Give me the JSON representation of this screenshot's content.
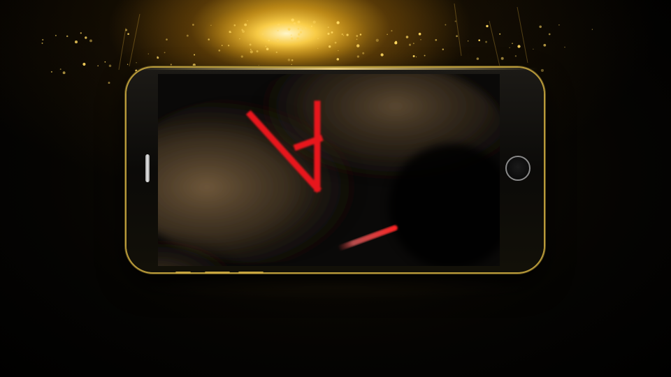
{
  "scene": {
    "colors": {
      "glow": "#f5c542",
      "phone_trim": "#b89a3a",
      "screen_bg": "#0a0908",
      "smoke": "#6b5330",
      "letter_red": "#e8191e"
    }
  },
  "phone": {
    "orientation": "landscape",
    "home_button_icon": "home-button-ring",
    "speaker_icon": "speaker-grille"
  },
  "screen": {
    "letter": "A",
    "letter_orientation": "upside-down",
    "streak": "red-light-streak"
  }
}
